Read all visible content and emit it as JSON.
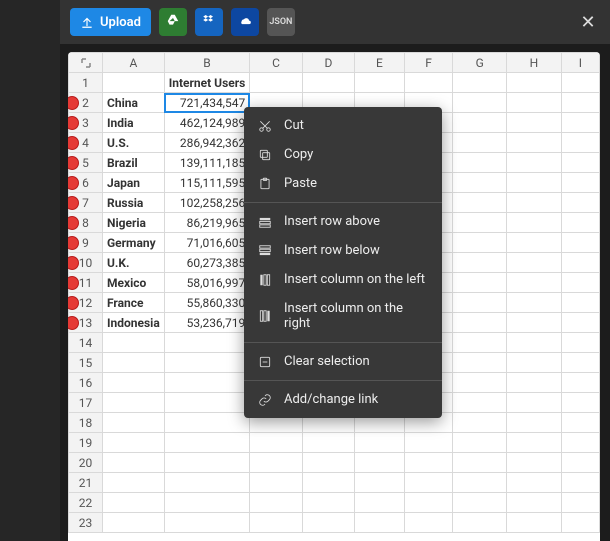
{
  "toolbar": {
    "upload_label": "Upload",
    "json_label": "JSON"
  },
  "columns": [
    "A",
    "B",
    "C",
    "D",
    "E",
    "F",
    "G",
    "H",
    "I"
  ],
  "header_b": "Internet Users",
  "rows": [
    {
      "n": 1
    },
    {
      "n": 2,
      "a": "China",
      "b": "721,434,547",
      "dot": true,
      "selected": true
    },
    {
      "n": 3,
      "a": "India",
      "b": "462,124,989",
      "dot": true
    },
    {
      "n": 4,
      "a": "U.S.",
      "b": "286,942,362",
      "dot": true
    },
    {
      "n": 5,
      "a": "Brazil",
      "b": "139,111,185",
      "dot": true
    },
    {
      "n": 6,
      "a": "Japan",
      "b": "115,111,595",
      "dot": true
    },
    {
      "n": 7,
      "a": "Russia",
      "b": "102,258,256",
      "dot": true
    },
    {
      "n": 8,
      "a": "Nigeria",
      "b": "86,219,965",
      "dot": true
    },
    {
      "n": 9,
      "a": "Germany",
      "b": "71,016,605",
      "dot": true
    },
    {
      "n": 10,
      "a": "U.K.",
      "b": "60,273,385",
      "dot": true
    },
    {
      "n": 11,
      "a": "Mexico",
      "b": "58,016,997",
      "dot": true
    },
    {
      "n": 12,
      "a": "France",
      "b": "55,860,330",
      "dot": true
    },
    {
      "n": 13,
      "a": "Indonesia",
      "b": "53,236,719",
      "dot": true
    },
    {
      "n": 14
    },
    {
      "n": 15
    },
    {
      "n": 16
    },
    {
      "n": 17
    },
    {
      "n": 18
    },
    {
      "n": 19
    },
    {
      "n": 20
    },
    {
      "n": 21
    },
    {
      "n": 22
    },
    {
      "n": 23
    }
  ],
  "context_menu": {
    "cut": "Cut",
    "copy": "Copy",
    "paste": "Paste",
    "insert_row_above": "Insert row above",
    "insert_row_below": "Insert row below",
    "insert_col_left": "Insert column on the left",
    "insert_col_right": "Insert column on the right",
    "clear_selection": "Clear selection",
    "add_link": "Add/change link"
  }
}
